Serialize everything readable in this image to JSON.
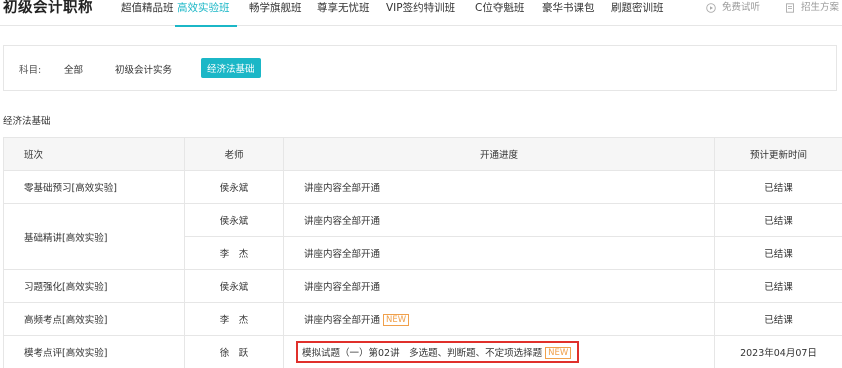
{
  "nav": {
    "brand": "初级会计职称",
    "items": [
      {
        "label": "超值精品班",
        "active": false
      },
      {
        "label": "高效实验班",
        "active": true
      },
      {
        "label": "畅学旗舰班",
        "active": false
      },
      {
        "label": "尊享无忧班",
        "active": false
      },
      {
        "label": "VIP签约特训班",
        "active": false
      },
      {
        "label": "C位夺魁班",
        "active": false
      },
      {
        "label": "豪华书课包",
        "active": false
      },
      {
        "label": "刷题密训班",
        "active": false
      }
    ],
    "free_trial": "免费试听",
    "admissions": "招生方案"
  },
  "filter": {
    "label": "科目:",
    "options": [
      {
        "label": "全部",
        "active": false
      },
      {
        "label": "初级会计实务",
        "active": false
      },
      {
        "label": "经济法基础",
        "active": true
      }
    ]
  },
  "section_title": "经济法基础",
  "table": {
    "headers": [
      "班次",
      "老师",
      "开通进度",
      "预计更新时间"
    ],
    "rows": [
      {
        "class": "零基础预习[高效实验]",
        "teacher": "侯永斌",
        "progress": "讲座内容全部开通",
        "new": "",
        "time": "已结课"
      },
      {
        "class": "基础精讲[高效实验]",
        "teacher": "侯永斌",
        "progress": "讲座内容全部开通",
        "new": "",
        "time": "已结课"
      },
      {
        "class": "",
        "teacher": "李　杰",
        "progress": "讲座内容全部开通",
        "new": "",
        "time": "已结课"
      },
      {
        "class": "习题强化[高效实验]",
        "teacher": "侯永斌",
        "progress": "讲座内容全部开通",
        "new": "",
        "time": "已结课"
      },
      {
        "class": "高频考点[高效实验]",
        "teacher": "李　杰",
        "progress": "讲座内容全部开通",
        "new": "NEW",
        "time": "已结课"
      },
      {
        "class": "模考点评[高效实验]",
        "teacher": "徐　跃",
        "progress": "模拟试题（一）第02讲　多选题、判断题、不定项选择题",
        "new": "NEW",
        "time": "2023年04月07日"
      }
    ]
  },
  "colors": {
    "accent": "#1bb7c7",
    "new_tag": "#f0a04b",
    "highlight": "#e0302b"
  }
}
